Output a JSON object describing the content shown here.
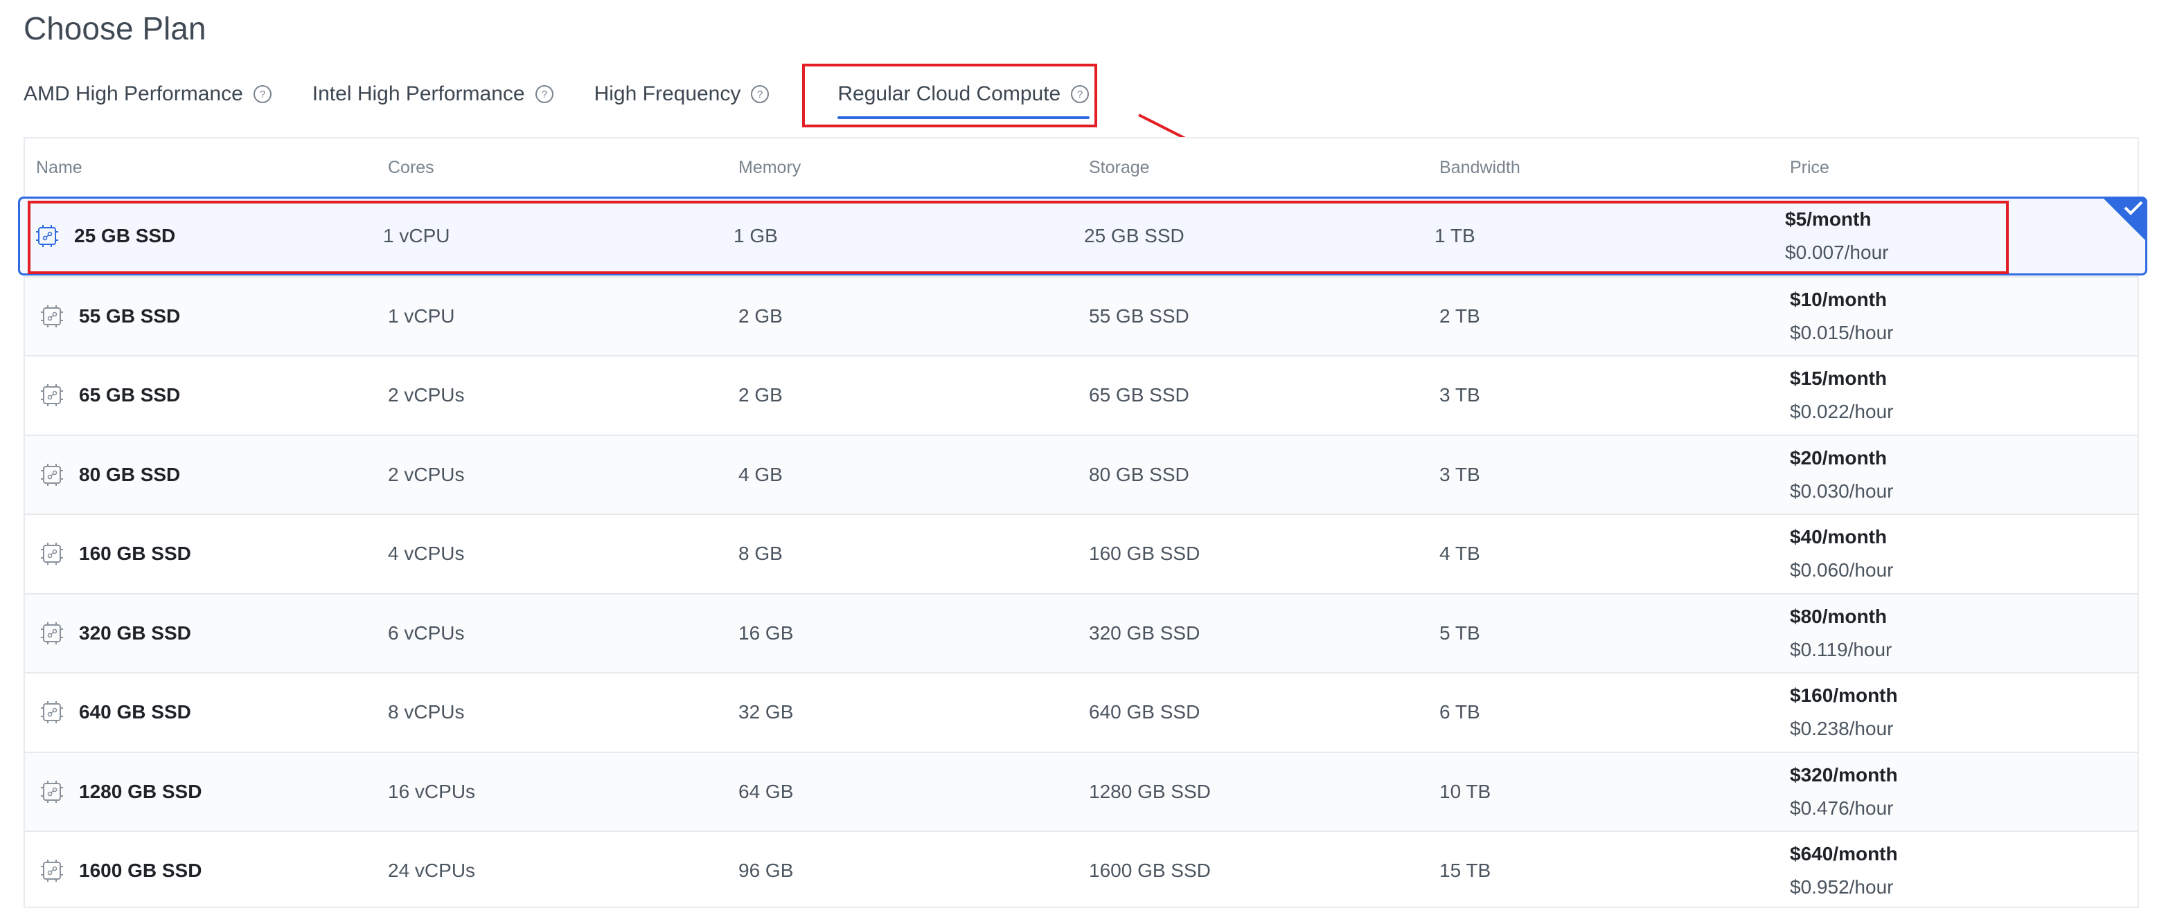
{
  "page": {
    "title": "Choose Plan"
  },
  "tabs": [
    {
      "label": "AMD High Performance",
      "active": false
    },
    {
      "label": "Intel High Performance",
      "active": false
    },
    {
      "label": "High Frequency",
      "active": false
    },
    {
      "label": "Regular Cloud Compute",
      "active": true
    }
  ],
  "table": {
    "headers": {
      "name": "Name",
      "cores": "Cores",
      "memory": "Memory",
      "storage": "Storage",
      "bandwidth": "Bandwidth",
      "price": "Price"
    },
    "rows": [
      {
        "name": "25 GB SSD",
        "cores": "1 vCPU",
        "memory": "1 GB",
        "storage": "25 GB SSD",
        "bandwidth": "1 TB",
        "price_month": "$5/month",
        "price_hour": "$0.007/hour",
        "selected": true
      },
      {
        "name": "55 GB SSD",
        "cores": "1 vCPU",
        "memory": "2 GB",
        "storage": "55 GB SSD",
        "bandwidth": "2 TB",
        "price_month": "$10/month",
        "price_hour": "$0.015/hour",
        "selected": false
      },
      {
        "name": "65 GB SSD",
        "cores": "2 vCPUs",
        "memory": "2 GB",
        "storage": "65 GB SSD",
        "bandwidth": "3 TB",
        "price_month": "$15/month",
        "price_hour": "$0.022/hour",
        "selected": false
      },
      {
        "name": "80 GB SSD",
        "cores": "2 vCPUs",
        "memory": "4 GB",
        "storage": "80 GB SSD",
        "bandwidth": "3 TB",
        "price_month": "$20/month",
        "price_hour": "$0.030/hour",
        "selected": false
      },
      {
        "name": "160 GB SSD",
        "cores": "4 vCPUs",
        "memory": "8 GB",
        "storage": "160 GB SSD",
        "bandwidth": "4 TB",
        "price_month": "$40/month",
        "price_hour": "$0.060/hour",
        "selected": false
      },
      {
        "name": "320 GB SSD",
        "cores": "6 vCPUs",
        "memory": "16 GB",
        "storage": "320 GB SSD",
        "bandwidth": "5 TB",
        "price_month": "$80/month",
        "price_hour": "$0.119/hour",
        "selected": false
      },
      {
        "name": "640 GB SSD",
        "cores": "8 vCPUs",
        "memory": "32 GB",
        "storage": "640 GB SSD",
        "bandwidth": "6 TB",
        "price_month": "$160/month",
        "price_hour": "$0.238/hour",
        "selected": false
      },
      {
        "name": "1280 GB SSD",
        "cores": "16 vCPUs",
        "memory": "64 GB",
        "storage": "1280 GB SSD",
        "bandwidth": "10 TB",
        "price_month": "$320/month",
        "price_hour": "$0.476/hour",
        "selected": false
      },
      {
        "name": "1600 GB SSD",
        "cores": "24 vCPUs",
        "memory": "96 GB",
        "storage": "1600 GB SSD",
        "bandwidth": "15 TB",
        "price_month": "$640/month",
        "price_hour": "$0.952/hour",
        "selected": false
      }
    ]
  },
  "icons": {
    "tab_help": "question-circle-icon",
    "plan": "cpu-chip-icon",
    "selected": "checkmark-icon"
  },
  "colors": {
    "accent": "#2f6ae0",
    "annotation": "#e31e24"
  }
}
